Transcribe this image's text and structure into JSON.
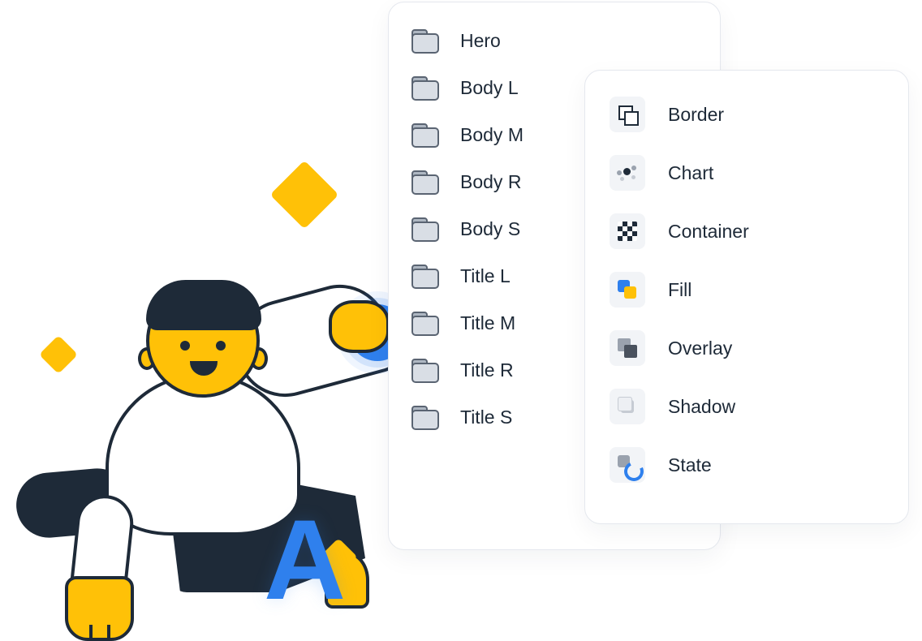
{
  "typography_panel": {
    "items": [
      {
        "label": "Hero"
      },
      {
        "label": "Body L"
      },
      {
        "label": "Body M"
      },
      {
        "label": "Body R"
      },
      {
        "label": "Body S"
      },
      {
        "label": "Title L"
      },
      {
        "label": "Title M"
      },
      {
        "label": "Title R"
      },
      {
        "label": "Title S"
      }
    ]
  },
  "styles_panel": {
    "items": [
      {
        "icon": "border-icon",
        "label": "Border"
      },
      {
        "icon": "chart-icon",
        "label": "Chart"
      },
      {
        "icon": "container-icon",
        "label": "Container"
      },
      {
        "icon": "fill-icon",
        "label": "Fill"
      },
      {
        "icon": "overlay-icon",
        "label": "Overlay"
      },
      {
        "icon": "shadow-icon",
        "label": "Shadow"
      },
      {
        "icon": "state-icon",
        "label": "State"
      }
    ]
  },
  "illustration": {
    "letter_glyph": "A"
  },
  "colors": {
    "accent_yellow": "#FFC107",
    "accent_blue": "#2F80ED",
    "text": "#1E2A38",
    "tile_bg": "#F2F4F7",
    "panel_border": "#E5E8EE"
  }
}
